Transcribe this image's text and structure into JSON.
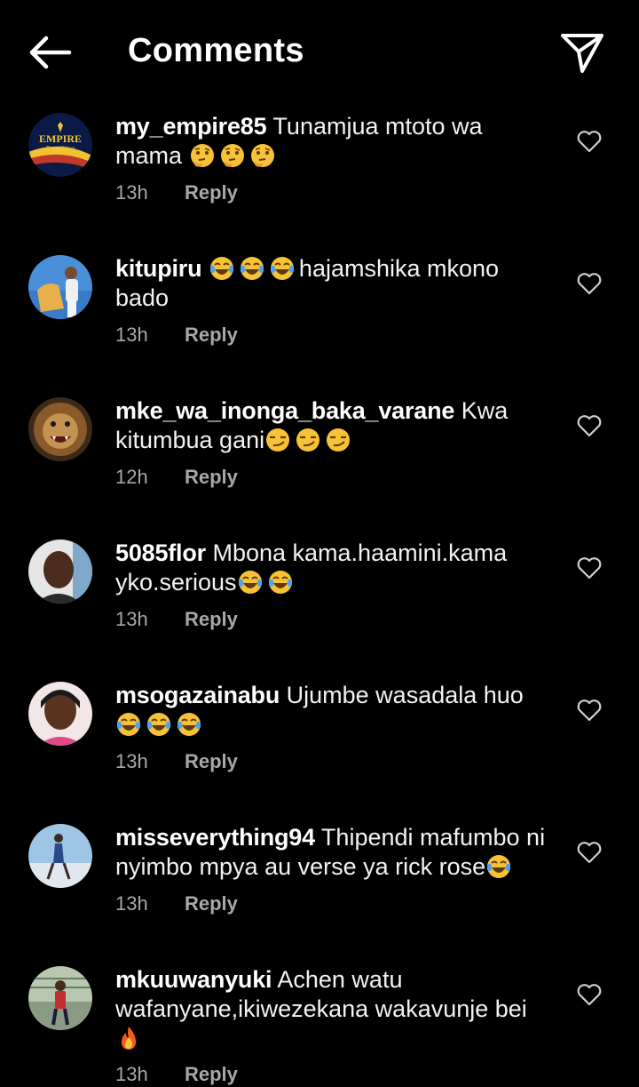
{
  "header": {
    "title": "Comments",
    "back_icon": "arrow-left-icon",
    "share_icon": "paper-plane-icon"
  },
  "reply_label": "Reply",
  "comments": [
    {
      "username": "my_empire85",
      "text": " Tunamjua mtoto wa mama ",
      "emojis": [
        "thinking-face",
        "thinking-face",
        "thinking-face"
      ],
      "emoji_position": "end",
      "time": "13h"
    },
    {
      "username": "kitupiru",
      "text": "hajamshika mkono bado",
      "emojis": [
        "tears-of-joy",
        "tears-of-joy",
        "tears-of-joy"
      ],
      "emoji_position": "start",
      "time": "13h"
    },
    {
      "username": "mke_wa_inonga_baka_varane",
      "text": " Kwa kitumbua gani",
      "emojis": [
        "smirking-face",
        "smirking-face",
        "smirking-face"
      ],
      "emoji_position": "end",
      "time": "12h"
    },
    {
      "username": "5085flor",
      "text": " Mbona kama.haamini.kama yko.serious",
      "emojis": [
        "tears-of-joy",
        "tears-of-joy"
      ],
      "emoji_position": "end",
      "time": "13h"
    },
    {
      "username": "msogazainabu",
      "text": " Ujumbe wasadala huo ",
      "emojis": [
        "tears-of-joy",
        "tears-of-joy",
        "tears-of-joy"
      ],
      "emoji_position": "end",
      "time": "13h"
    },
    {
      "username": "misseverything94",
      "text": " Thipendi mafumbo ni nyimbo mpya au verse ya rick rose",
      "emojis": [
        "tears-of-joy"
      ],
      "emoji_position": "end",
      "time": "13h"
    },
    {
      "username": "mkuuwanyuki",
      "text": " Achen watu wafanyane,ikiwezekana wakavunje bei ",
      "emojis": [
        "fire"
      ],
      "emoji_position": "end",
      "time": "13h"
    }
  ],
  "avatar_logo_text": {
    "line1": "EMPIRE",
    "line2": "Royal Wave"
  }
}
